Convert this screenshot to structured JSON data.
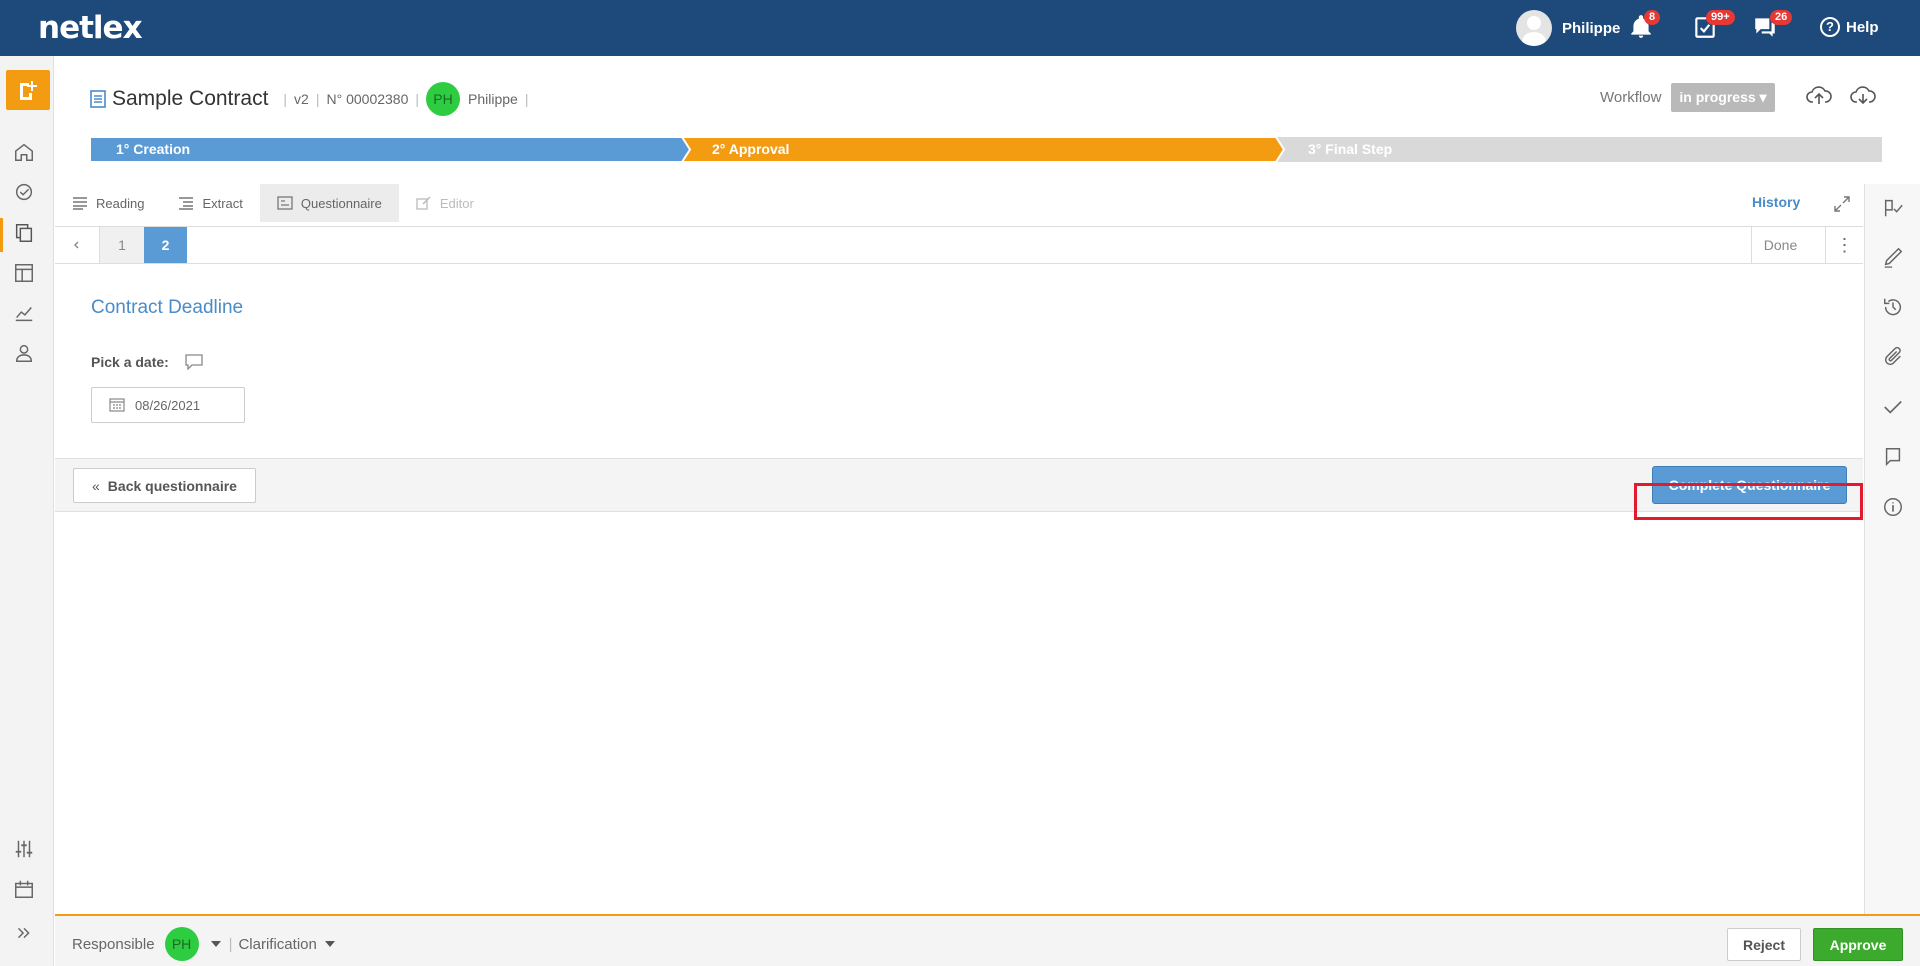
{
  "app": {
    "logo": "netlex"
  },
  "topbar": {
    "user_name": "Philippe",
    "notifications_count": "8",
    "tasks_count": "99+",
    "messages_count": "26",
    "help_label": "Help"
  },
  "document": {
    "title": "Sample Contract",
    "version": "v2",
    "number": "N° 00002380",
    "owner_initials": "PH",
    "owner_name": "Philippe"
  },
  "workflow": {
    "label": "Workflow",
    "status": "in progress"
  },
  "steps": [
    {
      "label": "1° Creation",
      "state": "done",
      "color": "#5b9bd5"
    },
    {
      "label": "2° Approval",
      "state": "current",
      "color": "#f39c12"
    },
    {
      "label": "3° Final Step",
      "state": "pending",
      "color": "#d9d9d9"
    }
  ],
  "tabs": [
    {
      "label": "Reading",
      "icon": "reading-icon"
    },
    {
      "label": "Extract",
      "icon": "extract-icon"
    },
    {
      "label": "Questionnaire",
      "icon": "questionnaire-icon",
      "active": true
    },
    {
      "label": "Editor",
      "icon": "edit-icon",
      "disabled": true
    }
  ],
  "history_label": "History",
  "pagination": {
    "pages": [
      "1",
      "2"
    ],
    "current": "2",
    "done_label": "Done"
  },
  "question": {
    "section_title": "Contract Deadline",
    "label": "Pick a date:",
    "date_value": "08/26/2021"
  },
  "actions": {
    "back_label": "Back questionnaire",
    "complete_label": "Complete Questionnaire",
    "highlight_color": "#e3192e"
  },
  "bottombar": {
    "responsible_label": "Responsible",
    "responsible_initials": "PH",
    "clarification_label": "Clarification",
    "reject_label": "Reject",
    "approve_label": "Approve"
  }
}
